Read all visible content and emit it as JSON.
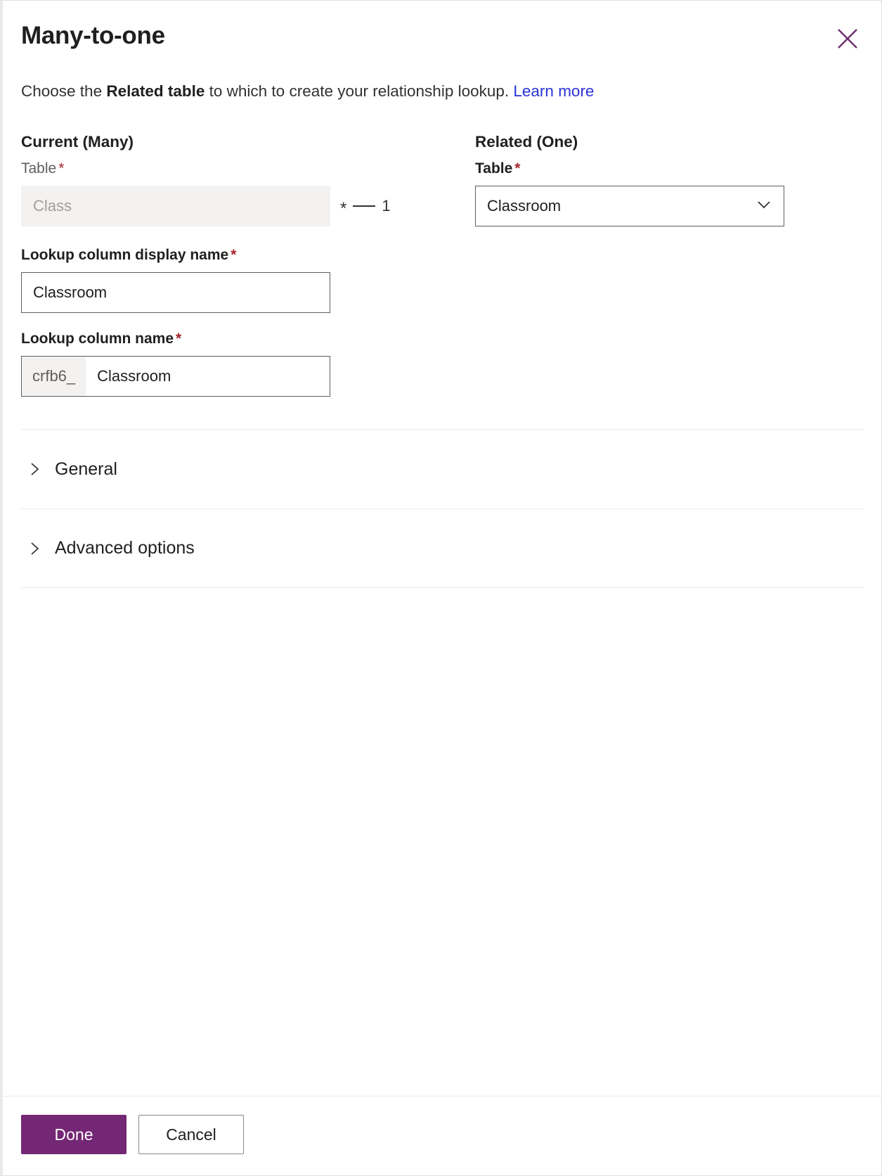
{
  "dialog": {
    "title": "Many-to-one",
    "close_icon": "close-icon",
    "description": {
      "prefix": "Choose the ",
      "bold": "Related table",
      "suffix": " to which to create your relationship lookup. ",
      "link": "Learn more"
    }
  },
  "current": {
    "group_title": "Current (Many)",
    "table_label": "Table",
    "required_mark": "*",
    "table_value": "Class"
  },
  "related": {
    "group_title": "Related (One)",
    "table_label": "Table",
    "required_mark": "*",
    "table_value": "Classroom",
    "chevron_icon": "chevron-down-icon"
  },
  "cardinality": {
    "many": "*",
    "one": "1"
  },
  "lookup_display": {
    "label": "Lookup column display name",
    "required_mark": "*",
    "value": "Classroom"
  },
  "lookup_name": {
    "label": "Lookup column name",
    "required_mark": "*",
    "prefix": "crfb6_",
    "value": "Classroom"
  },
  "accordion": {
    "items": [
      {
        "label": "General",
        "icon": "chevron-right-icon"
      },
      {
        "label": "Advanced options",
        "icon": "chevron-right-icon"
      }
    ]
  },
  "footer": {
    "done_label": "Done",
    "cancel_label": "Cancel"
  },
  "colors": {
    "primary": "#742774",
    "link": "#2b32d4",
    "required": "#a4262c",
    "disabled_bg": "#f3f2f1",
    "border": "#605e5c"
  }
}
